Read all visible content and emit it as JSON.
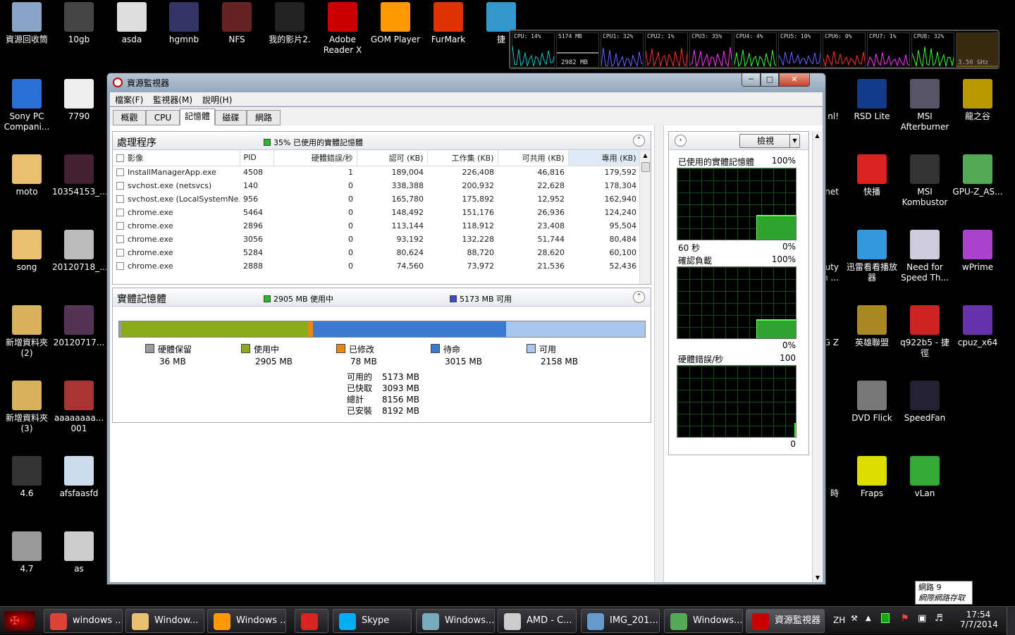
{
  "desktop_icons": [
    {
      "label": "資源回收筒",
      "color": "#8aa4c8"
    },
    {
      "label": "10gb",
      "color": "#444"
    },
    {
      "label": "asda",
      "color": "#ddd"
    },
    {
      "label": "hgmnb",
      "color": "#336"
    },
    {
      "label": "NFS",
      "color": "#622"
    },
    {
      "label": "我的影片2.",
      "color": "#222"
    },
    {
      "label": "Adobe Reader X",
      "color": "#c00"
    },
    {
      "label": "GOM Player",
      "color": "#f90"
    },
    {
      "label": "FurMark",
      "color": "#d30"
    },
    {
      "label": "捷",
      "color": "#39c"
    },
    {
      "label": "Sony PC Compani...",
      "color": "#2a6fd6"
    },
    {
      "label": "7790",
      "color": "#eee"
    },
    {
      "label": "moto",
      "color": "#e8c070"
    },
    {
      "label": "10354153_...",
      "color": "#423"
    },
    {
      "label": "song",
      "color": "#e8c070"
    },
    {
      "label": "20120718_...",
      "color": "#bbb"
    },
    {
      "label": "新增資料夾 (2)",
      "color": "#d9b35c"
    },
    {
      "label": "20120717...",
      "color": "#535"
    },
    {
      "label": "新增資料夾 (3)",
      "color": "#d9b35c"
    },
    {
      "label": "aaaaaaaa... 001",
      "color": "#a33"
    },
    {
      "label": "4.6",
      "color": "#333"
    },
    {
      "label": "afsfaasfd",
      "color": "#cde"
    },
    {
      "label": "4.7",
      "color": "#999"
    },
    {
      "label": "as",
      "color": "#ccc"
    },
    {
      "label": "RSD Lite",
      "color": "#123a8a"
    },
    {
      "label": "MSI Afterburner",
      "color": "#556"
    },
    {
      "label": "龍之谷",
      "color": "#b90"
    },
    {
      "label": "快播",
      "color": "#d22"
    },
    {
      "label": "MSI Kombustor",
      "color": "#333"
    },
    {
      "label": "GPU-Z_AS...",
      "color": "#5a5"
    },
    {
      "label": "迅雷看看播放器",
      "color": "#39d"
    },
    {
      "label": "Need for Speed Th...",
      "color": "#ccd"
    },
    {
      "label": "wPrime",
      "color": "#a4c"
    },
    {
      "label": "英雄聯盟",
      "color": "#a82"
    },
    {
      "label": "q922b5 - 捷徑",
      "color": "#c22"
    },
    {
      "label": "cpuz_x64",
      "color": "#63a"
    },
    {
      "label": "DVD Flick",
      "color": "#777"
    },
    {
      "label": "SpeedFan",
      "color": "#223"
    },
    {
      "label": "Fraps",
      "color": "#dd0"
    },
    {
      "label": "vLan",
      "color": "#3a3"
    },
    {
      "label": "nl!",
      "color": "#000"
    },
    {
      "label": "net",
      "color": "#000"
    },
    {
      "label": "Duty h ...",
      "color": "#000"
    },
    {
      "label": "OG Z",
      "color": "#000"
    },
    {
      "label": "時",
      "color": "#000"
    }
  ],
  "gadget": {
    "cells": [
      "CPU: 14%",
      "5174 MB",
      "CPU1: 32%",
      "CPU2: 1%",
      "CPU3: 35%",
      "CPU4: 4%",
      "CPU5: 10%",
      "CPU6: 0%",
      "CPU7: 1%",
      "CPU8: 32%",
      ""
    ],
    "mem_bottom": "2982 MB",
    "freq": "3.50 GHz",
    "colors": [
      "#0cc",
      "#fff",
      "#66f",
      "#f33",
      "#f3f",
      "#3f3",
      "#66f",
      "#f33",
      "#f3f",
      "#3f3",
      "#a80"
    ]
  },
  "window": {
    "title": "資源監視器",
    "menu": [
      "檔案(F)",
      "監視器(M)",
      "說明(H)"
    ],
    "tabs": [
      "概觀",
      "CPU",
      "記憶體",
      "磁碟",
      "網路"
    ],
    "processes": {
      "title": "處理程序",
      "info": "35% 已使用的實體記憶體",
      "columns": [
        "影像",
        "PID",
        "硬體錯誤/秒",
        "認可 (KB)",
        "工作集 (KB)",
        "可共用 (KB)",
        "專用 (KB)"
      ],
      "rows": [
        [
          "InstallManagerApp.exe",
          "4508",
          "1",
          "189,004",
          "226,408",
          "46,816",
          "179,592"
        ],
        [
          "svchost.exe (netsvcs)",
          "140",
          "0",
          "338,388",
          "200,932",
          "22,628",
          "178,304"
        ],
        [
          "svchost.exe (LocalSystemNe...",
          "956",
          "0",
          "165,780",
          "175,892",
          "12,952",
          "162,940"
        ],
        [
          "chrome.exe",
          "5464",
          "0",
          "148,492",
          "151,176",
          "26,936",
          "124,240"
        ],
        [
          "chrome.exe",
          "2896",
          "0",
          "113,144",
          "118,912",
          "23,408",
          "95,504"
        ],
        [
          "chrome.exe",
          "3056",
          "0",
          "93,192",
          "132,228",
          "51,744",
          "80,484"
        ],
        [
          "chrome.exe",
          "5284",
          "0",
          "80,624",
          "88,720",
          "28,620",
          "60,100"
        ],
        [
          "chrome.exe",
          "2888",
          "0",
          "74,560",
          "73,972",
          "21,536",
          "52,436"
        ]
      ]
    },
    "physical": {
      "title": "實體記憶體",
      "in_use": "2905 MB 使用中",
      "available": "5173 MB 可用",
      "segments": [
        {
          "name": "硬體保留",
          "value_mb": 36,
          "label": "36 MB",
          "color": "#9c9c9c"
        },
        {
          "name": "使用中",
          "value_mb": 2905,
          "label": "2905 MB",
          "color": "#8aac1a"
        },
        {
          "name": "已修改",
          "value_mb": 78,
          "label": "78 MB",
          "color": "#e88a12"
        },
        {
          "name": "待命",
          "value_mb": 3015,
          "label": "3015 MB",
          "color": "#3a7ad0"
        },
        {
          "name": "可用",
          "value_mb": 2158,
          "label": "2158 MB",
          "color": "#a9c6ec"
        }
      ],
      "summary": [
        [
          "可用的",
          "5173 MB"
        ],
        [
          "已快取",
          "3093 MB"
        ],
        [
          "總計",
          "8156 MB"
        ],
        [
          "已安裝",
          "8192 MB"
        ]
      ]
    },
    "side": {
      "view_label": "檢視",
      "graphs": [
        {
          "title": "已使用的實體記憶體",
          "max": "100%",
          "bottom_left": "60 秒",
          "bottom_right": "0%",
          "level": 0.35
        },
        {
          "title": "確認負載",
          "max": "100%",
          "bottom_left": "",
          "bottom_right": "0%",
          "level": 0.27
        },
        {
          "title": "硬體錯誤/秒",
          "max": "100",
          "bottom_left": "",
          "bottom_right": "0",
          "level": 0.0
        }
      ]
    }
  },
  "taskbar": {
    "items": [
      {
        "label": "windows ...",
        "color": "#db4437"
      },
      {
        "label": "Window...",
        "color": "#e8c070"
      },
      {
        "label": "Windows ...",
        "color": "#f90"
      },
      {
        "label": "",
        "color": "#d22"
      },
      {
        "label": "Skype",
        "color": "#00aff0"
      },
      {
        "label": "Windows...",
        "color": "#7ab"
      },
      {
        "label": "AMD - C...",
        "color": "#ccc"
      },
      {
        "label": "IMG_201...",
        "color": "#69c"
      },
      {
        "label": "Windows...",
        "color": "#5a5"
      },
      {
        "label": "資源監視器",
        "color": "#c00"
      }
    ],
    "lang": "ZH",
    "time": "17:54",
    "date": "7/7/2014",
    "tooltip_line1": "網路 9",
    "tooltip_line2": "網際網路存取"
  }
}
